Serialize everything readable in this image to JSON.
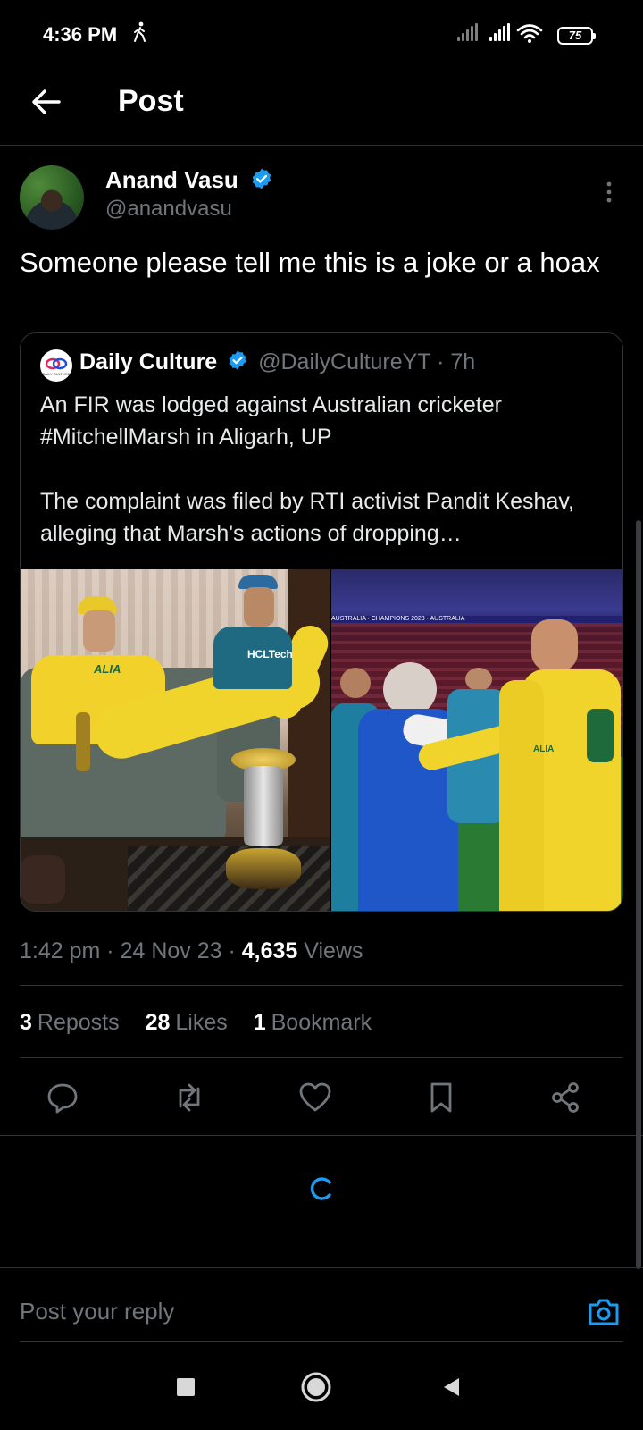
{
  "status_bar": {
    "time": "4:36 PM",
    "battery": "75"
  },
  "header": {
    "title": "Post"
  },
  "tweet": {
    "author_name": "Anand Vasu",
    "author_handle": "@anandvasu",
    "text": "Someone please tell me this is a joke or a hoax",
    "time": "1:42 pm",
    "date": "24 Nov 23",
    "views_count": "4,635",
    "views_label": "Views",
    "reposts_count": "3",
    "reposts_label": "Reposts",
    "likes_count": "28",
    "likes_label": "Likes",
    "bookmarks_count": "1",
    "bookmarks_label": "Bookmark"
  },
  "quote": {
    "name": "Daily Culture",
    "handle": "@DailyCultureYT",
    "age": "7h",
    "logo_text": "DAILY CULTURE",
    "line1": "An FIR was lodged against Australian cricketer #MitchellMarsh in Aligarh, UP",
    "line2": "The complaint was filed by RTI activist Pandit Keshav, alleging that Marsh's actions of dropping…",
    "img1_jersey": "HCLTech",
    "img1_shirt": "ALIA",
    "img2_banner": "AUSTRALIA  ·  CHAMPIONS 2023  ·  AUSTRALIA",
    "img2_shirt": "ALIA"
  },
  "reply": {
    "placeholder": "Post your reply"
  },
  "colors": {
    "accent": "#1d9bf0",
    "background": "#000000",
    "muted": "#71767b"
  }
}
